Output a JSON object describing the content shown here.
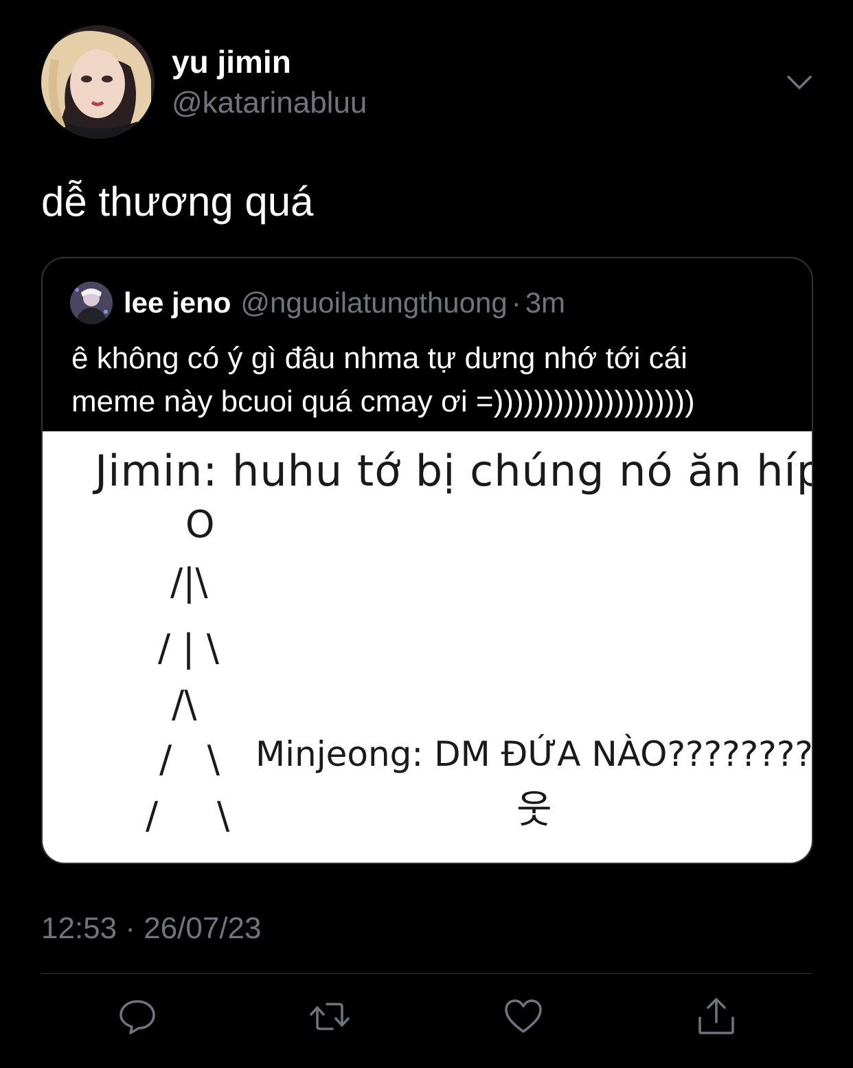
{
  "author": {
    "display_name": "yu jimin",
    "handle": "@katarinabluu",
    "avatar_icon": "profile-photo"
  },
  "tweet": {
    "text": "dễ thương quá",
    "timestamp": "12:53 · 26/07/23"
  },
  "quoted_tweet": {
    "display_name": "lee jeno",
    "handle": "@nguoilatungthuong",
    "separator": "·",
    "time": "3m",
    "text_lines": [
      "ê không có ý gì đâu nhma tự dưng nhớ tới cái",
      "meme này bcuoi quá cmay ơi =))))))))))))))))))))"
    ],
    "meme": {
      "line1": "Jimin: huhu tớ bị chúng nó ăn híp",
      "stick_figure": [
        "O",
        "/|\\",
        "/ | \\",
        "/\\",
        "/   \\",
        "/     \\"
      ],
      "line2": "Minjeong: DM ĐỨA NÀO????????",
      "character": "웃"
    }
  },
  "actions": {
    "reply_icon": "speech-bubble-icon",
    "retweet_icon": "retweet-arrows-icon",
    "like_icon": "heart-icon",
    "share_icon": "share-upload-icon"
  },
  "colors": {
    "background": "#000000",
    "primary_text": "#ffffff",
    "secondary_text": "#6e767d",
    "border": "#2f3336"
  }
}
